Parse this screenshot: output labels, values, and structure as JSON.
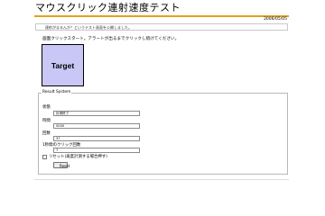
{
  "page": {
    "title": "マウスクリック連射速度テスト",
    "date": "2006/05/05",
    "notice": "連射がまるんか？というテスト画面を公開しました。",
    "instruction": "画面クリックスタート。アラートが出るまでクリックし続けてください。"
  },
  "target": {
    "label": "Target"
  },
  "result": {
    "legend": "Result System",
    "state_label": "状態",
    "state_value": "計測終了",
    "time_label": "時間",
    "time_value": "5000",
    "count_label": "回数",
    "count_value": "37",
    "rate_label": "1秒間のクリック回数",
    "rate_value": "7",
    "repeat_label": "リセット(再度計測する場合押す)",
    "reset_button": "Reset"
  }
}
